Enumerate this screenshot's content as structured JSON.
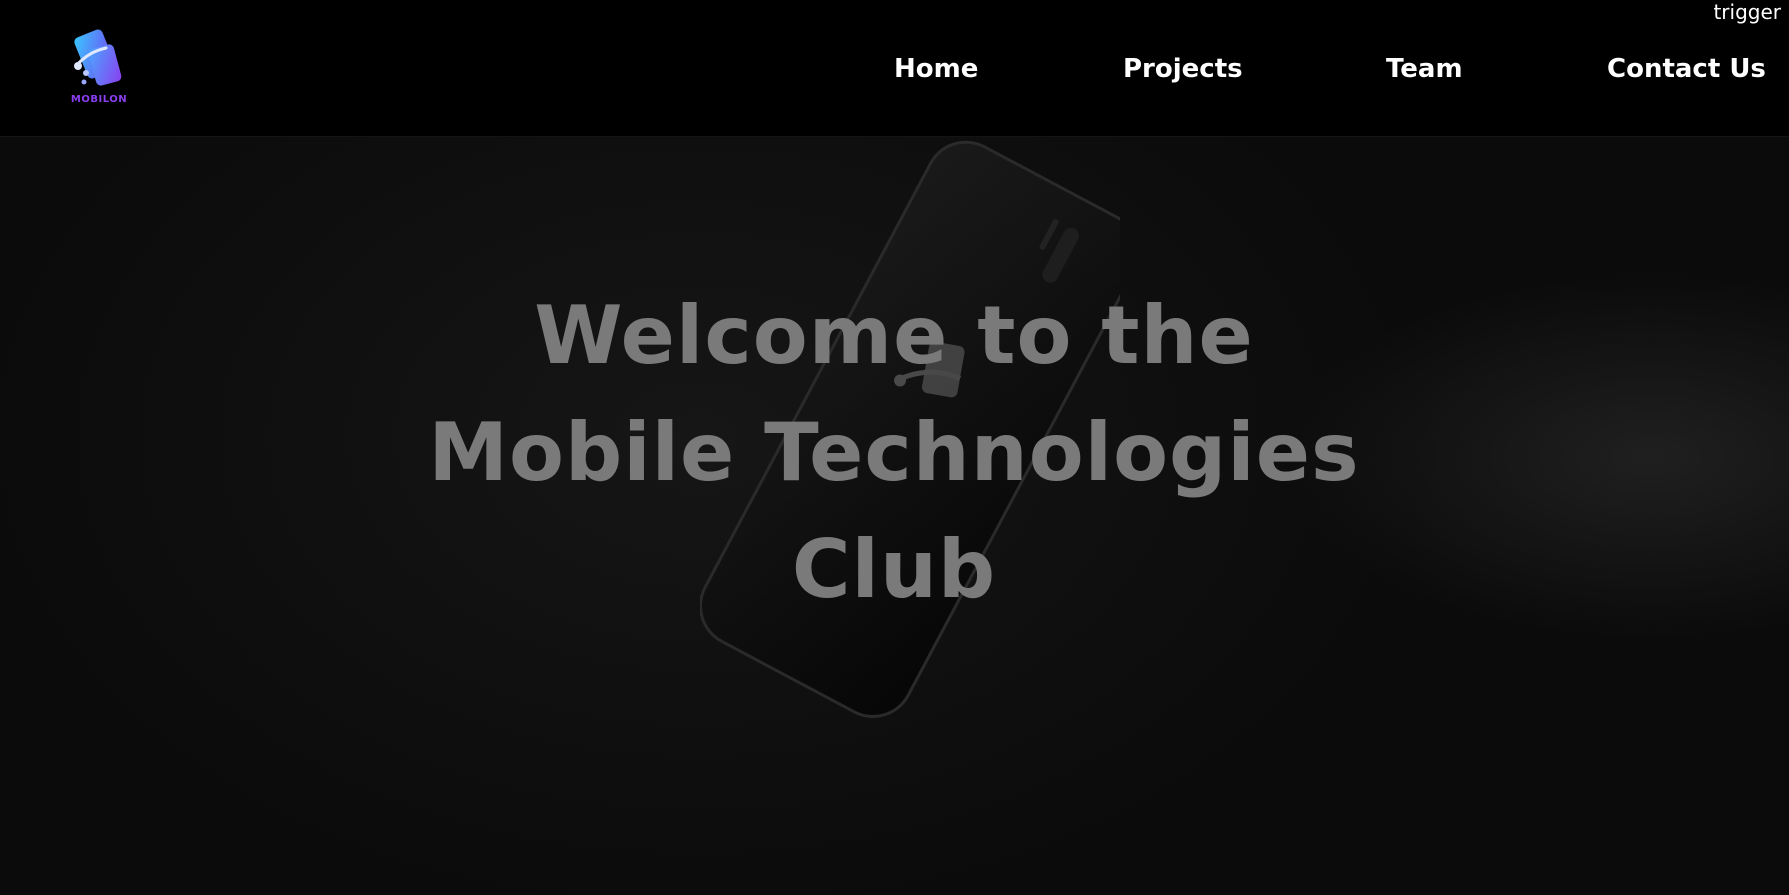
{
  "header": {
    "logo_text": "MOBILON",
    "nav": {
      "home": "Home",
      "projects": "Projects",
      "team": "Team",
      "contact": "Contact Us"
    },
    "trigger": "trigger"
  },
  "hero": {
    "title_line1": "Welcome to the",
    "title_line2": "Mobile Technologies",
    "title_line3": "Club",
    "phone_brand": "MOBILON"
  },
  "colors": {
    "logo_purple": "#8a3ff0",
    "logo_blue": "#3fb6ff",
    "nav_text": "#ffffff",
    "hero_text": "#7a7a7a",
    "background": "#000000"
  }
}
